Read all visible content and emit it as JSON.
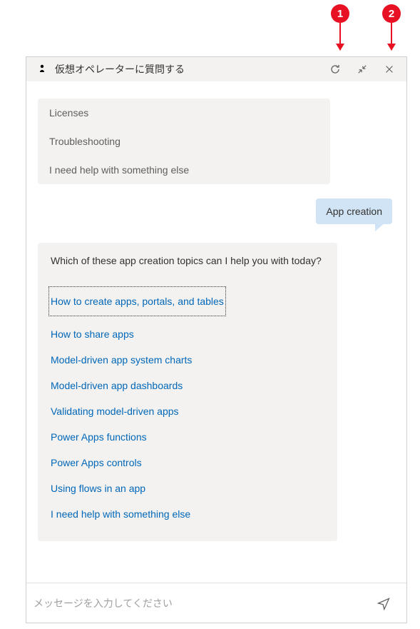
{
  "callouts": {
    "c1": "1",
    "c2": "2"
  },
  "header": {
    "title": "仮想オペレーターに質問する"
  },
  "chat": {
    "prevOptions": [
      "Licenses",
      "Troubleshooting",
      "I need help with something else"
    ],
    "userMessage": "App creation",
    "botPrompt": "Which of these app creation topics can I help you with today?",
    "linkOptions": [
      "How to create apps, portals, and tables",
      "How to share apps",
      "Model-driven app system charts",
      "Model-driven app dashboards",
      "Validating model-driven apps",
      "Power Apps functions",
      "Power Apps controls",
      "Using flows in an app",
      "I need help with something else"
    ]
  },
  "input": {
    "placeholder": "メッセージを入力してください"
  }
}
